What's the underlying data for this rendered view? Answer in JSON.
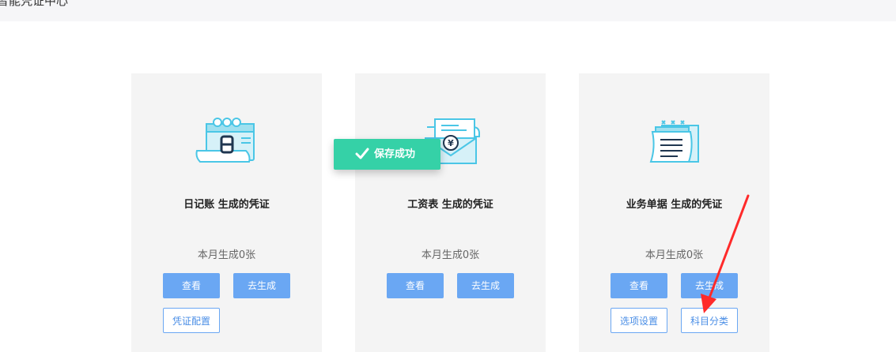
{
  "header": {
    "title": "智能凭证中心"
  },
  "cards": [
    {
      "title": "日记账 生成的凭证",
      "count": "本月生成0张",
      "buttons": {
        "view": "查看",
        "generate": "去生成"
      },
      "secondary": [
        "凭证配置"
      ],
      "icon": "calendar-icon"
    },
    {
      "title": "工资表 生成的凭证",
      "count": "本月生成0张",
      "buttons": {
        "view": "查看",
        "generate": "去生成"
      },
      "secondary": [],
      "icon": "salary-envelope-icon"
    },
    {
      "title": "业务单据 生成的凭证",
      "count": "本月生成0张",
      "buttons": {
        "view": "查看",
        "generate": "去生成"
      },
      "secondary": [
        "选项设置",
        "科目分类"
      ],
      "icon": "document-icon"
    }
  ],
  "toast": {
    "message": "保存成功",
    "icon": "check-icon"
  },
  "colors": {
    "primary": "#6aa7f3",
    "icon_teal": "#4ac6e6",
    "toast": "#35d1a7",
    "card_bg": "#f4f4f4",
    "annotation": "#ff2a2a"
  }
}
